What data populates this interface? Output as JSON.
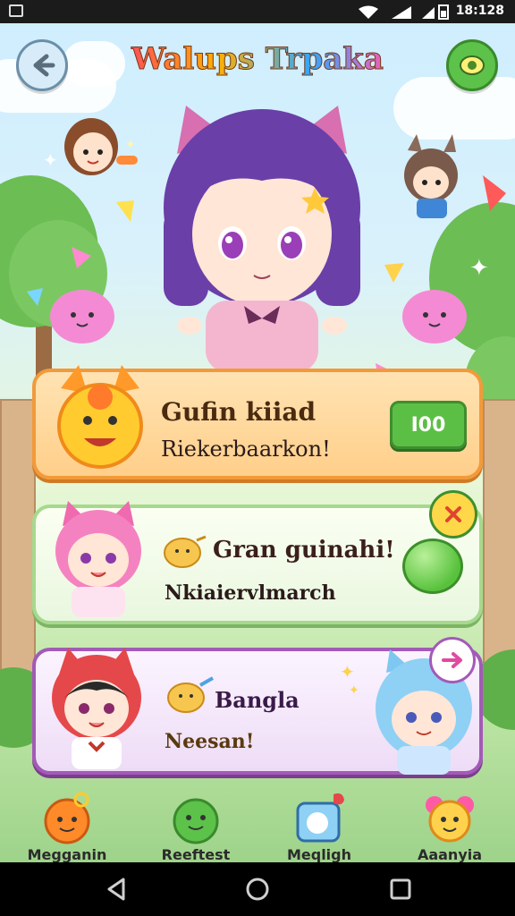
{
  "status_bar": {
    "time": "18:128"
  },
  "header": {
    "title": "Walups Trpaka"
  },
  "cards": [
    {
      "title": "Gufin kiiad",
      "subtitle": "Riekerbaarkon!",
      "button_label": "I00"
    },
    {
      "title": "Gran guinahi!",
      "subtitle": "Nkiaiervlmarch"
    },
    {
      "title": "Bangla",
      "subtitle": "Neesan!"
    }
  ],
  "bottom_nav": [
    {
      "label": "Megganin",
      "icon": "pumpkin-mascot-icon",
      "color": "#ff8a2a"
    },
    {
      "label": "Reeftest",
      "icon": "green-slime-icon",
      "color": "#5cc24a"
    },
    {
      "label": "Meqligh",
      "icon": "chat-ghost-icon",
      "color": "#4da3e0"
    },
    {
      "label": "Aaanyia",
      "icon": "pink-bear-icon",
      "color": "#ff5aa5"
    }
  ],
  "colors": {
    "card1_border": "#f29a3a",
    "card2_border": "#a6d98e",
    "card3_border": "#a35ab8",
    "accent_green": "#5cbf45"
  }
}
